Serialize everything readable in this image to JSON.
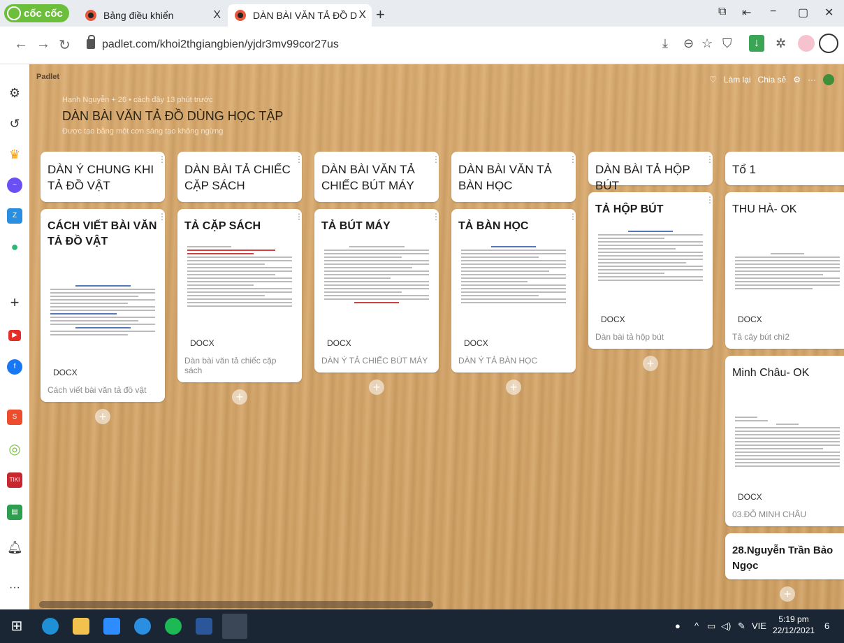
{
  "browser": {
    "brand": "cốc cốc",
    "tabs": [
      {
        "label": "Bảng điều khiển"
      },
      {
        "label": "DÀN BÀI VĂN TẢ ĐỒ DÙNG"
      }
    ],
    "url": "padlet.com/khoi2thgiangbien/yjdr3mv99cor27us",
    "new_tab": "+",
    "close": "X"
  },
  "padlet": {
    "logo": "Padlet",
    "actions": {
      "like": "♡",
      "remake": "Làm lại",
      "share": "Chia sẻ",
      "settings": "⚙",
      "more": "···"
    },
    "meta": "Hạnh Nguyễn + 26 • cách đây 13 phút trước",
    "title": "DÀN BÀI VĂN TẢ ĐỒ DÙNG HỌC TẬP",
    "subtitle": "Được tạo bằng một cơn sáng tạo không ngừng",
    "columns": [
      {
        "header": "DÀN Ý CHUNG KHI TẢ ĐỒ VẬT",
        "post_title": "CÁCH VIẾT BÀI VĂN TẢ ĐỒ VẬT",
        "badge": "DOCX",
        "caption": "Cách viết bài văn tả đồ vật"
      },
      {
        "header": "DÀN BÀI TẢ CHIẾC CẶP SÁCH",
        "post_title": "TẢ CẶP SÁCH",
        "badge": "DOCX",
        "caption": "Dàn bài văn tả chiếc cặp sách"
      },
      {
        "header": "DÀN BÀI VĂN TẢ CHIẾC BÚT MÁY",
        "post_title": "TẢ BÚT MÁY",
        "badge": "DOCX",
        "caption": "DÀN Ý TẢ CHIẾC BÚT MÁY"
      },
      {
        "header": "DÀN BÀI VĂN TẢ BÀN HỌC",
        "post_title": "TẢ BÀN HỌC",
        "badge": "DOCX",
        "caption": "DÀN Ý TẢ BÀN HỌC"
      },
      {
        "header": "DÀN BÀI TẢ HỘP BÚT",
        "post_title": "TẢ HỘP BÚT",
        "badge": "DOCX",
        "caption": "Dàn bài tả hộp bút"
      },
      {
        "header": "Tổ 1",
        "posts": [
          {
            "title": "THU HÀ- OK",
            "badge": "DOCX",
            "caption": "Tả cây bút chì2"
          },
          {
            "title": "Minh Châu- OK",
            "badge": "DOCX",
            "caption": "03.ĐỖ MINH CHÂU"
          },
          {
            "title": "28.Nguyễn Trần Bảo Ngọc"
          }
        ]
      }
    ],
    "add": "+"
  },
  "taskbar": {
    "time": "5:19 pm",
    "date": "22/12/2021",
    "lang": "VIE",
    "notif": "6"
  }
}
